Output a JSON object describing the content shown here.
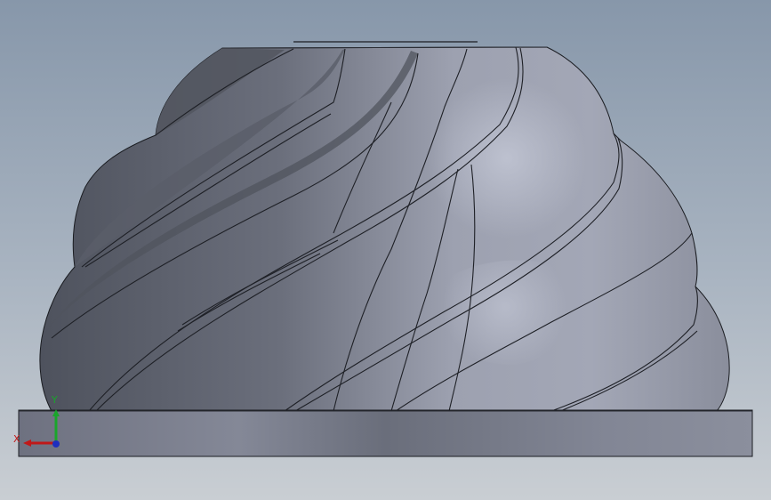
{
  "viewport": {
    "background_top": "#8797aa",
    "background_bottom": "#c9ced3",
    "model": {
      "part_color": "#8d929f",
      "shadow_color": "#4e525d",
      "highlight_color": "#c4c8d6",
      "base_plate_color": "#7a7e8c",
      "edge_color": "#1b1d22",
      "blade_count": 5
    },
    "triad": {
      "x_label": "X",
      "y_label": "Y",
      "x_color": "#c01818",
      "y_color": "#19a52b",
      "z_color": "#1e2fbf"
    }
  }
}
